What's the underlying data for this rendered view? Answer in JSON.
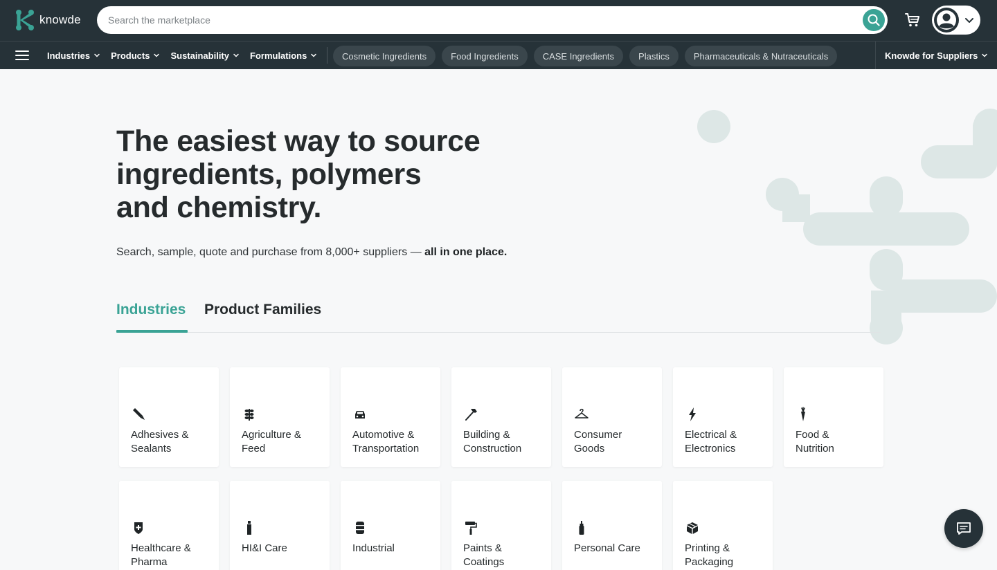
{
  "header": {
    "logo_text": "knowde",
    "search": {
      "placeholder": "Search the marketplace",
      "value": ""
    }
  },
  "nav": {
    "menus": [
      {
        "label": "Industries"
      },
      {
        "label": "Products"
      },
      {
        "label": "Sustainability"
      },
      {
        "label": "Formulations"
      }
    ],
    "pills": [
      {
        "label": "Cosmetic Ingredients"
      },
      {
        "label": "Food Ingredients"
      },
      {
        "label": "CASE Ingredients"
      },
      {
        "label": "Plastics"
      },
      {
        "label": "Pharmaceuticals & Nutraceuticals"
      }
    ],
    "suppliers_label": "Knowde for Suppliers"
  },
  "hero": {
    "title_line1": "The easiest way to source",
    "title_line2": "ingredients, polymers",
    "title_line3": "and chemistry.",
    "subtitle_prefix": "Search, sample, quote and purchase from 8,000+ suppliers — ",
    "subtitle_bold": "all in one place."
  },
  "tabs": {
    "industries": "Industries",
    "product_families": "Product Families",
    "active": "industries"
  },
  "industries": [
    {
      "line1": "Adhesives &",
      "line2": "Sealants",
      "icon": "glue-stick-icon"
    },
    {
      "line1": "Agriculture &",
      "line2": "Feed",
      "icon": "wheat-icon"
    },
    {
      "line1": "Automotive &",
      "line2": "Transportation",
      "icon": "car-icon"
    },
    {
      "line1": "Building &",
      "line2": "Construction",
      "icon": "hammer-icon"
    },
    {
      "line1": "Consumer",
      "line2": "Goods",
      "icon": "hanger-icon"
    },
    {
      "line1": "Electrical &",
      "line2": "Electronics",
      "icon": "lightning-icon"
    },
    {
      "line1": "Food &",
      "line2": "Nutrition",
      "icon": "carrot-icon"
    },
    {
      "line1": "Healthcare &",
      "line2": "Pharma",
      "icon": "medical-shield-icon"
    },
    {
      "line1": "HI&I Care",
      "line2": "",
      "icon": "spray-bottle-icon"
    },
    {
      "line1": "Industrial",
      "line2": "",
      "icon": "barrel-icon"
    },
    {
      "line1": "Paints &",
      "line2": "Coatings",
      "icon": "paint-roller-icon"
    },
    {
      "line1": "Personal Care",
      "line2": "",
      "icon": "lotion-bottle-icon"
    },
    {
      "line1": "Printing &",
      "line2": "Packaging",
      "icon": "package-icon"
    }
  ],
  "colors": {
    "header_bg": "#263238",
    "accent": "#3aa395",
    "page_bg": "#f7f8f9",
    "pill_bg": "#3a464c",
    "decoration": "#dde7e6"
  }
}
